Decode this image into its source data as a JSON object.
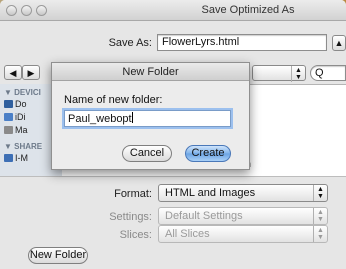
{
  "window": {
    "title": "Save Optimized As"
  },
  "save_as": {
    "label": "Save As:",
    "value": "FlowerLyrs.html"
  },
  "expand_button": {
    "glyph": "▲"
  },
  "nav": {
    "back_glyph": "◀",
    "forward_glyph": "▶",
    "search_glyph": "Q"
  },
  "sidebar": {
    "devices_header": "▼ DEVICI",
    "items": [
      {
        "label": "Do"
      },
      {
        "label": "iDi"
      },
      {
        "label": "Ma"
      }
    ],
    "shared_header": "▼ SHARE",
    "shared_items": [
      {
        "label": "I-M"
      }
    ]
  },
  "partial_text": {
    "n_glyph": "n"
  },
  "format": {
    "label": "Format:",
    "value": "HTML and Images"
  },
  "settings": {
    "label": "Settings:",
    "value": "Default Settings"
  },
  "slices": {
    "label": "Slices:",
    "value": "All Slices"
  },
  "buttons": {
    "new_folder": "New Folder"
  },
  "dialog": {
    "title": "New Folder",
    "prompt": "Name of new folder:",
    "input_value": "Paul_webopt",
    "cancel": "Cancel",
    "create": "Create"
  },
  "colors": {
    "accent": "#6aa3e3",
    "sidebar_bg": "#dde3ea",
    "window_bg": "#e6e6e6"
  }
}
